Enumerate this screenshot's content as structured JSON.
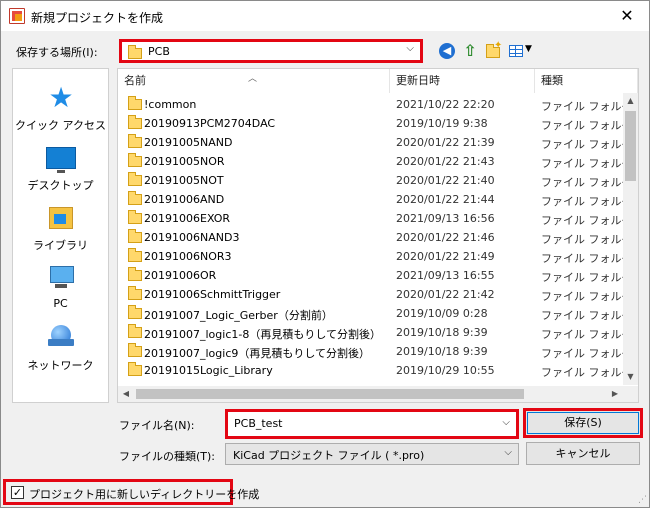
{
  "window": {
    "title": "新規プロジェクトを作成",
    "close_glyph": "✕"
  },
  "lookin": {
    "label": "保存する場所(I):",
    "value": "PCB"
  },
  "places": [
    {
      "label": "クイック アクセス",
      "icon": "quick-access-star-icon"
    },
    {
      "label": "デスクトップ",
      "icon": "desktop-icon"
    },
    {
      "label": "ライブラリ",
      "icon": "library-icon"
    },
    {
      "label": "PC",
      "icon": "pc-icon"
    },
    {
      "label": "ネットワーク",
      "icon": "network-icon"
    }
  ],
  "filelist": {
    "columns": [
      "名前",
      "更新日時",
      "種類"
    ],
    "rows": [
      {
        "name": "!common",
        "date": "2021/10/22 22:20",
        "type": "ファイル フォルダー"
      },
      {
        "name": "20190913PCM2704DAC",
        "date": "2019/10/19 9:38",
        "type": "ファイル フォルダー"
      },
      {
        "name": "20191005NAND",
        "date": "2020/01/22 21:39",
        "type": "ファイル フォルダー"
      },
      {
        "name": "20191005NOR",
        "date": "2020/01/22 21:43",
        "type": "ファイル フォルダー"
      },
      {
        "name": "20191005NOT",
        "date": "2020/01/22 21:40",
        "type": "ファイル フォルダー"
      },
      {
        "name": "20191006AND",
        "date": "2020/01/22 21:44",
        "type": "ファイル フォルダー"
      },
      {
        "name": "20191006EXOR",
        "date": "2021/09/13 16:56",
        "type": "ファイル フォルダー"
      },
      {
        "name": "20191006NAND3",
        "date": "2020/01/22 21:46",
        "type": "ファイル フォルダー"
      },
      {
        "name": "20191006NOR3",
        "date": "2020/01/22 21:49",
        "type": "ファイル フォルダー"
      },
      {
        "name": "20191006OR",
        "date": "2021/09/13 16:55",
        "type": "ファイル フォルダー"
      },
      {
        "name": "20191006SchmittTrigger",
        "date": "2020/01/22 21:42",
        "type": "ファイル フォルダー"
      },
      {
        "name": "20191007_Logic_Gerber（分割前）",
        "date": "2019/10/09 0:28",
        "type": "ファイル フォルダー"
      },
      {
        "name": "20191007_logic1-8（再見積もりして分割後）",
        "date": "2019/10/18 9:39",
        "type": "ファイル フォルダー"
      },
      {
        "name": "20191007_logic9（再見積もりして分割後）",
        "date": "2019/10/18 9:39",
        "type": "ファイル フォルダー"
      },
      {
        "name": "20191015Logic_Library",
        "date": "2019/10/29 10:55",
        "type": "ファイル フォルダー"
      }
    ]
  },
  "filename": {
    "label": "ファイル名(N):",
    "value": "PCB_test"
  },
  "filetype": {
    "label": "ファイルの種類(T):",
    "value": "KiCad プロジェクト ファイル ( *.pro)"
  },
  "buttons": {
    "save": "保存(S)",
    "cancel": "キャンセル"
  },
  "mkdir": {
    "label": "プロジェクト用に新しいディレクトリーを作成",
    "checked_glyph": "✓"
  }
}
